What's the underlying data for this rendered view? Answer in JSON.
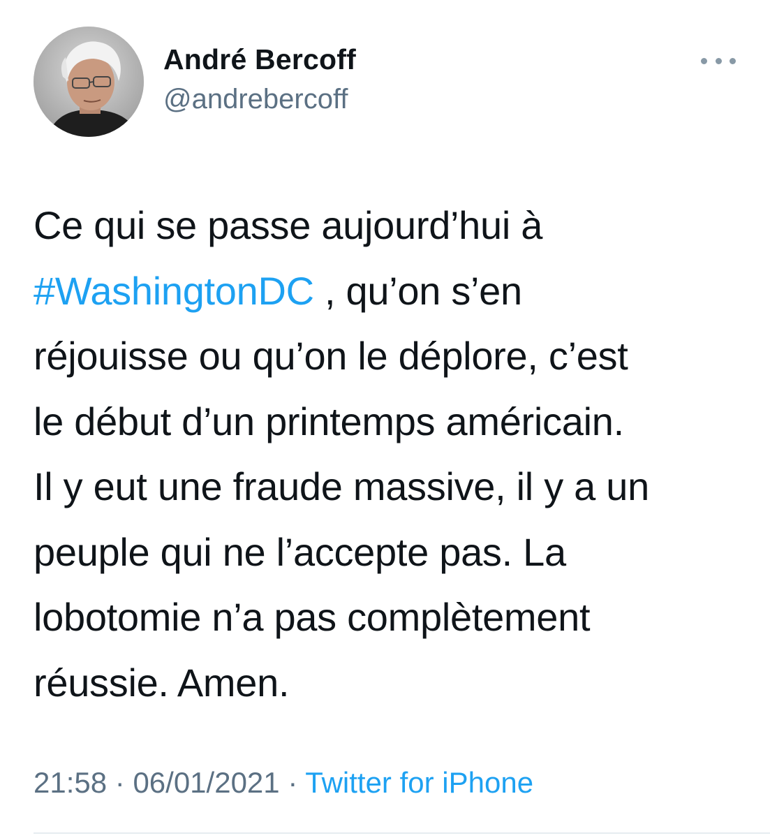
{
  "author": {
    "display_name": "André Bercoff",
    "handle": "@andrebercoff"
  },
  "more_icon": "more-horizontal-icon",
  "tweet": {
    "line1": "Ce qui se passe aujourd’hui à",
    "hashtag": "#WashingtonDC",
    "line2_rest": " , qu’on s’en",
    "line3": "réjouisse ou qu’on le déplore, c’est",
    "line4": "le début d’un printemps américain.",
    "line5": "Il y eut une fraude massive, il y a un",
    "line6": "peuple qui ne l’accepte pas. La",
    "line7": "lobotomie n’a pas complètement",
    "line8": "réussie. Amen."
  },
  "meta": {
    "time": "21:58",
    "separator": " · ",
    "date": "06/01/2021",
    "source": "Twitter for iPhone"
  },
  "colors": {
    "link": "#1da1f2",
    "secondary_text": "#5b7083",
    "primary_text": "#0f1419"
  }
}
